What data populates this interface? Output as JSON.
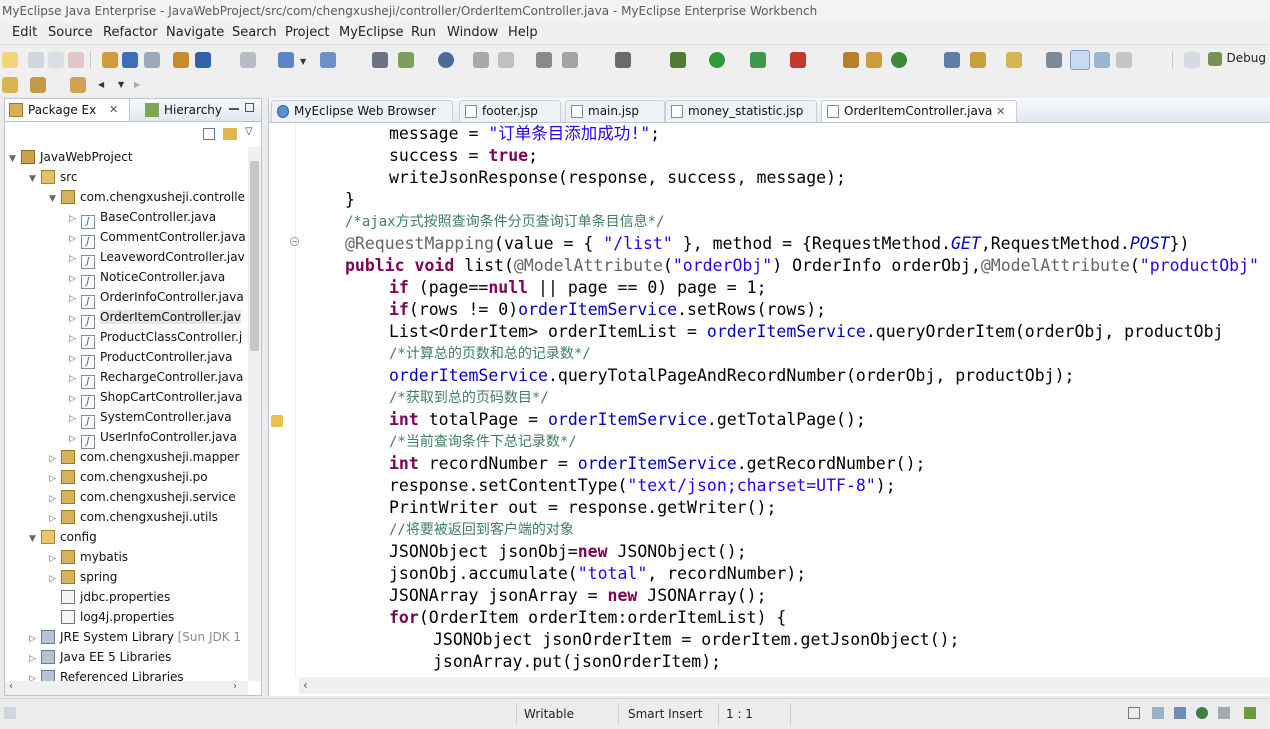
{
  "window": {
    "title": "MyEclipse Java Enterprise - JavaWebProject/src/com/chengxusheji/controller/OrderItemController.java - MyEclipse Enterprise Workbench"
  },
  "menu": {
    "items": [
      "Edit",
      "Source",
      "Refactor",
      "Navigate",
      "Search",
      "Project",
      "MyEclipse",
      "Run",
      "Window",
      "Help"
    ]
  },
  "toolbar": {
    "perspective_label": "Debug"
  },
  "left_panel": {
    "tabs": [
      {
        "label": "Package Ex",
        "close": "✕"
      },
      {
        "label": "Hierarchy"
      }
    ],
    "tree": [
      {
        "label": "JavaWebProject",
        "icon": "project-icon"
      },
      {
        "label": "src",
        "icon": "source-folder-icon"
      },
      {
        "label": "com.chengxusheji.controlle",
        "icon": "package-icon"
      },
      {
        "label": "BaseController.java",
        "icon": "java-file-icon"
      },
      {
        "label": "CommentController.java",
        "icon": "java-file-icon"
      },
      {
        "label": "LeavewordController.jav",
        "icon": "java-file-icon"
      },
      {
        "label": "NoticeController.java",
        "icon": "java-file-icon"
      },
      {
        "label": "OrderInfoController.java",
        "icon": "java-file-icon"
      },
      {
        "label": "OrderItemController.jav",
        "icon": "java-file-icon"
      },
      {
        "label": "ProductClassController.j",
        "icon": "java-file-icon"
      },
      {
        "label": "ProductController.java",
        "icon": "java-file-icon"
      },
      {
        "label": "RechargeController.java",
        "icon": "java-file-icon"
      },
      {
        "label": "ShopCartController.java",
        "icon": "java-file-icon"
      },
      {
        "label": "SystemController.java",
        "icon": "java-file-icon"
      },
      {
        "label": "UserInfoController.java",
        "icon": "java-file-icon"
      },
      {
        "label": "com.chengxusheji.mapper",
        "icon": "package-icon"
      },
      {
        "label": "com.chengxusheji.po",
        "icon": "package-icon"
      },
      {
        "label": "com.chengxusheji.service",
        "icon": "package-icon"
      },
      {
        "label": "com.chengxusheji.utils",
        "icon": "package-icon"
      },
      {
        "label": "config",
        "icon": "folder-icon"
      },
      {
        "label": "mybatis",
        "icon": "package-icon"
      },
      {
        "label": "spring",
        "icon": "package-icon"
      },
      {
        "label": "jdbc.properties",
        "icon": "properties-file-icon"
      },
      {
        "label": "log4j.properties",
        "icon": "properties-file-icon"
      },
      {
        "label": "JRE System Library",
        "suffix": "[Sun JDK 1",
        "icon": "library-icon"
      },
      {
        "label": "Java EE 5 Libraries",
        "icon": "library-icon"
      },
      {
        "label": "Referenced Libraries",
        "icon": "library-icon"
      }
    ]
  },
  "editor": {
    "tabs": [
      {
        "label": "MyEclipse Web Browser"
      },
      {
        "label": "footer.jsp"
      },
      {
        "label": "main.jsp"
      },
      {
        "label": "money_statistic.jsp"
      },
      {
        "label": "OrderItemController.java",
        "close": "✕"
      }
    ],
    "code": {
      "l1_var": "message = ",
      "l1_str": "\"订单条目添加成功!\"",
      "l1_end": ";",
      "l2_var": "success = ",
      "l2_kw": "true",
      "l2_end": ";",
      "l3": "writeJsonResponse(response, success, message);",
      "l4": "}",
      "l5": "/*ajax方式按照查询条件分页查询订单条目信息*/",
      "l6_ann": "@RequestMapping",
      "l6_a": "(value = { ",
      "l6_str": "\"/list\"",
      "l6_b": " }, method = {RequestMethod.",
      "l6_get": "GET",
      "l6_c": ",RequestMethod.",
      "l6_post": "POST",
      "l6_d": "})",
      "l7_kw1": "public",
      "l7_kw2": "void",
      "l7_a": " list(",
      "l7_ann1": "@ModelAttribute",
      "l7_b": "(",
      "l7_str1": "\"orderObj\"",
      "l7_c": ") OrderInfo orderObj,",
      "l7_ann2": "@ModelAttribute",
      "l7_d": "(",
      "l7_str2": "\"productObj\"",
      "l8_kw": "if",
      "l8_a": " (page==",
      "l8_null": "null",
      "l8_b": " || page == 0) page = 1;",
      "l9_kw": "if",
      "l9_a": "(rows != 0)",
      "l9_fld": "orderItemService",
      "l9_b": ".setRows(rows);",
      "l10_a": "List<OrderItem> orderItemList = ",
      "l10_fld": "orderItemService",
      "l10_b": ".queryOrderItem(orderObj, productObj",
      "l11": "/*计算总的页数和总的记录数*/",
      "l12_fld": "orderItemService",
      "l12_b": ".queryTotalPageAndRecordNumber(orderObj, productObj);",
      "l13": "/*获取到总的页码数目*/",
      "l14_kw": "int",
      "l14_a": " totalPage = ",
      "l14_fld": "orderItemService",
      "l14_b": ".getTotalPage();",
      "l15": "/*当前查询条件下总记录数*/",
      "l16_kw": "int",
      "l16_a": " recordNumber = ",
      "l16_fld": "orderItemService",
      "l16_b": ".getRecordNumber();",
      "l17_a": "response.setContentType(",
      "l17_str": "\"text/json;charset=UTF-8\"",
      "l17_b": ");",
      "l18": "PrintWriter out = response.getWriter();",
      "l19": "//将要被返回到客户端的对象",
      "l20_a": "JSONObject jsonObj=",
      "l20_kw": "new",
      "l20_b": " JSONObject();",
      "l21_a": "jsonObj.accumulate(",
      "l21_str": "\"total\"",
      "l21_b": ", recordNumber);",
      "l22_a": "JSONArray jsonArray = ",
      "l22_kw": "new",
      "l22_b": " JSONArray();",
      "l23_kw": "for",
      "l23_a": "(OrderItem orderItem:orderItemList) {",
      "l24": "JSONObject jsonOrderItem = orderItem.getJsonObject();",
      "l25": "jsonArray.put(jsonOrderItem);"
    }
  },
  "status": {
    "writable": "Writable",
    "insert_mode": "Smart Insert",
    "cursor": "1 : 1"
  }
}
